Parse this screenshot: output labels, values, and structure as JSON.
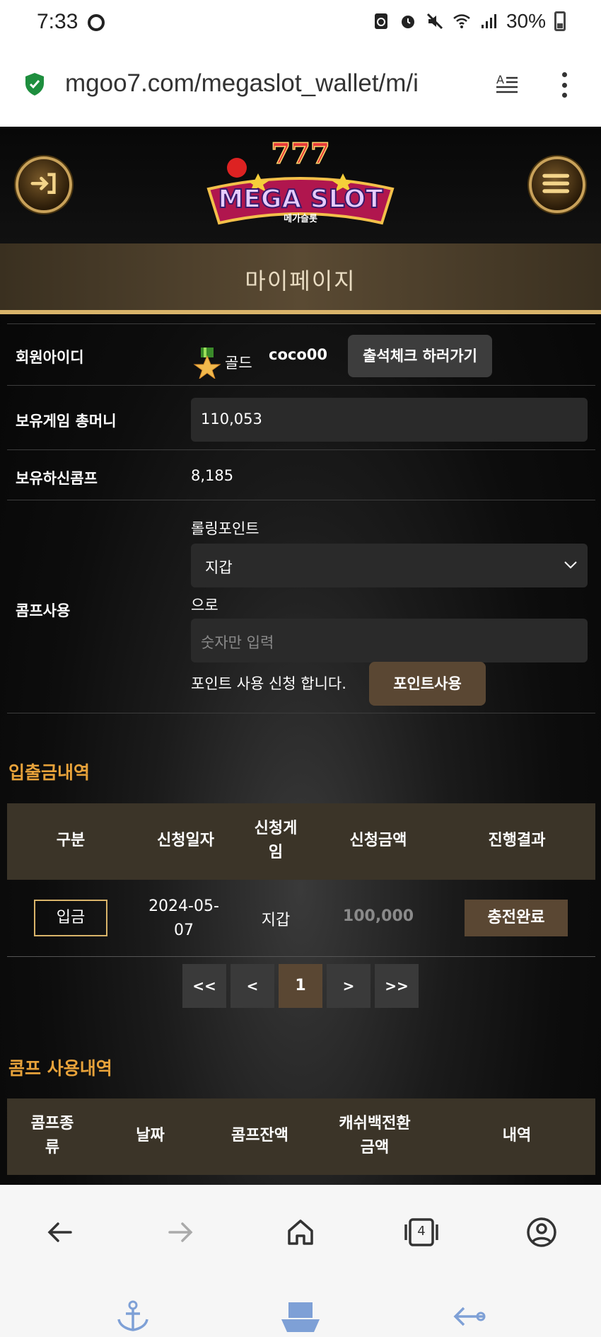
{
  "status_bar": {
    "time": "7:33",
    "battery": "30%"
  },
  "browser": {
    "url": "mgoo7.com/megaslot_wallet/m/i",
    "tab_count": "4"
  },
  "site": {
    "logo_text": "MEGA SLOT",
    "logo_sub": "메가슬롯",
    "page_title": "마이페이지"
  },
  "profile": {
    "member_id_label": "회원아이디",
    "grade": "골드",
    "user_id": "coco00",
    "attendance_button": "출석체크 하러가기",
    "game_money_label": "보유게임 총머니",
    "game_money_value": "110,053",
    "comp_label": "보유하신콤프",
    "comp_value": "8,185",
    "comp_use_label": "콤프사용",
    "rolling_label": "롤링포인트",
    "select_value": "지갑",
    "to_label": "으로",
    "amount_placeholder": "숫자만 입력",
    "apply_text": "포인트 사용 신청 합니다.",
    "point_use_button": "포인트사용"
  },
  "deposit_history": {
    "title": "입출금내역",
    "headers": [
      "구분",
      "신청일자",
      "신청게\n임",
      "신청금액",
      "진행결과"
    ],
    "row": {
      "type": "입금",
      "date": "2024-05-\n07",
      "game": "지갑",
      "amount": "100,000",
      "result": "충전완료"
    }
  },
  "pagination": {
    "first": "<<",
    "prev": "<",
    "current": "1",
    "next": ">",
    "last": ">>"
  },
  "comp_history": {
    "title": "콤프 사용내역",
    "headers": [
      "콤프종\n류",
      "날짜",
      "콤프잔액",
      "캐쉬백전환\n금액",
      "내역"
    ]
  }
}
